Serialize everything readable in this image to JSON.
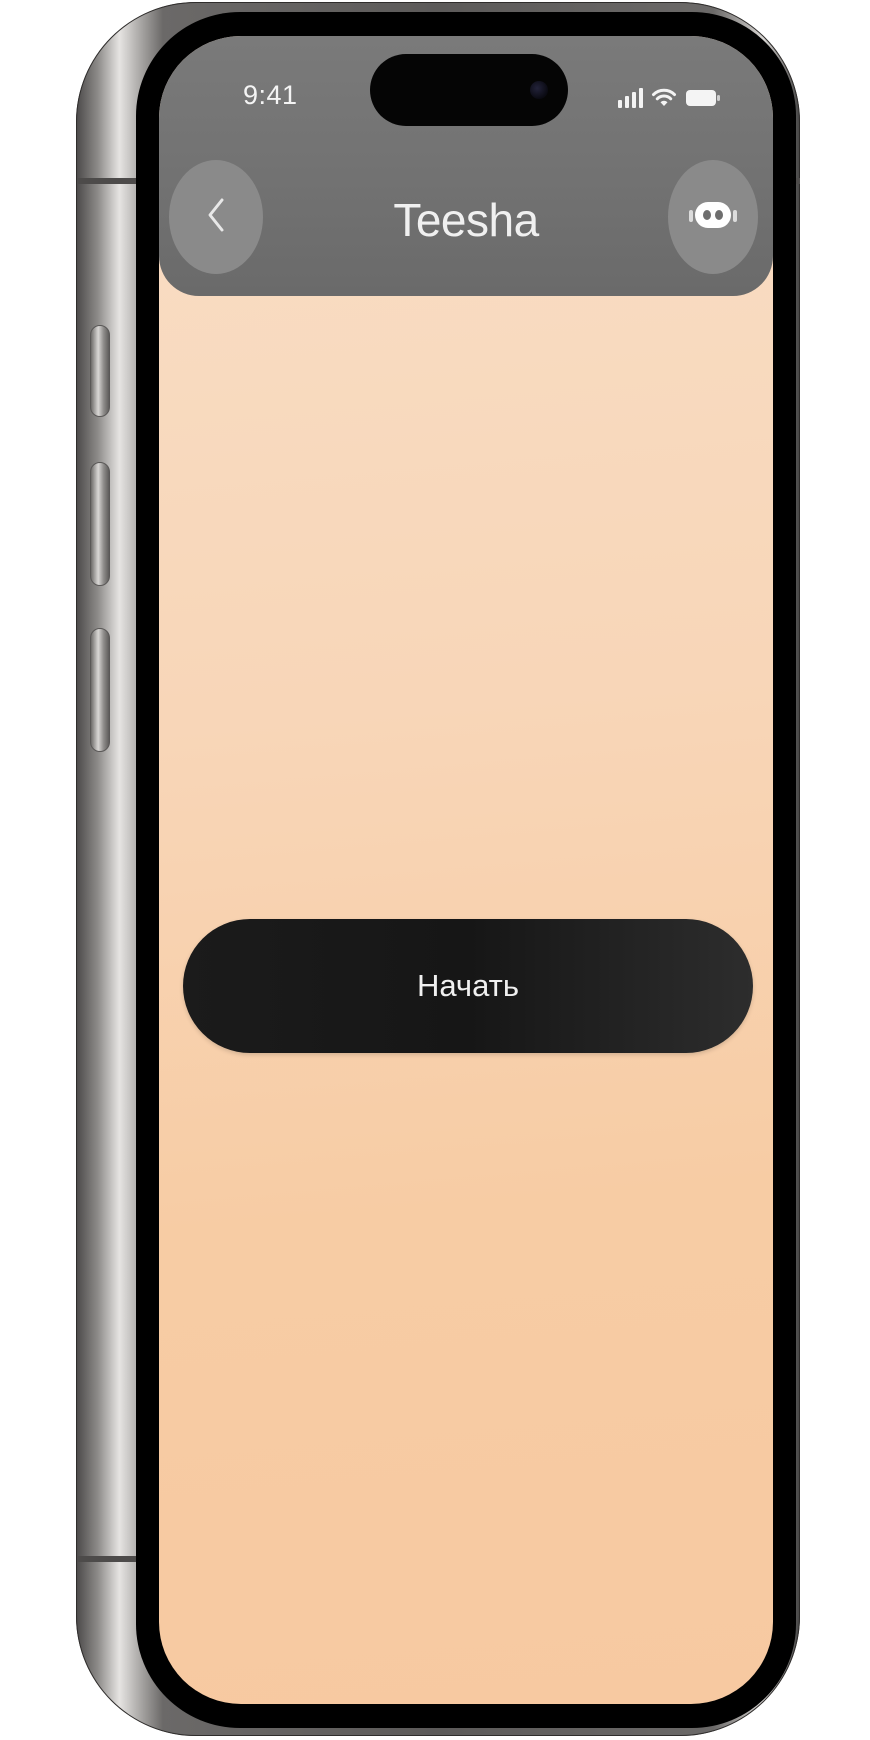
{
  "status_bar": {
    "time": "9:41"
  },
  "header": {
    "title": "Teesha",
    "back_icon": "chevron-left-icon",
    "bot_icon": "robot-face-icon"
  },
  "main": {
    "start_label": "Начать"
  },
  "colors": {
    "header_bg": "#727272",
    "screen_bg_top": "#f9dec6",
    "screen_bg_bottom": "#f7c9a1",
    "button_bg": "#1b1b1b"
  }
}
